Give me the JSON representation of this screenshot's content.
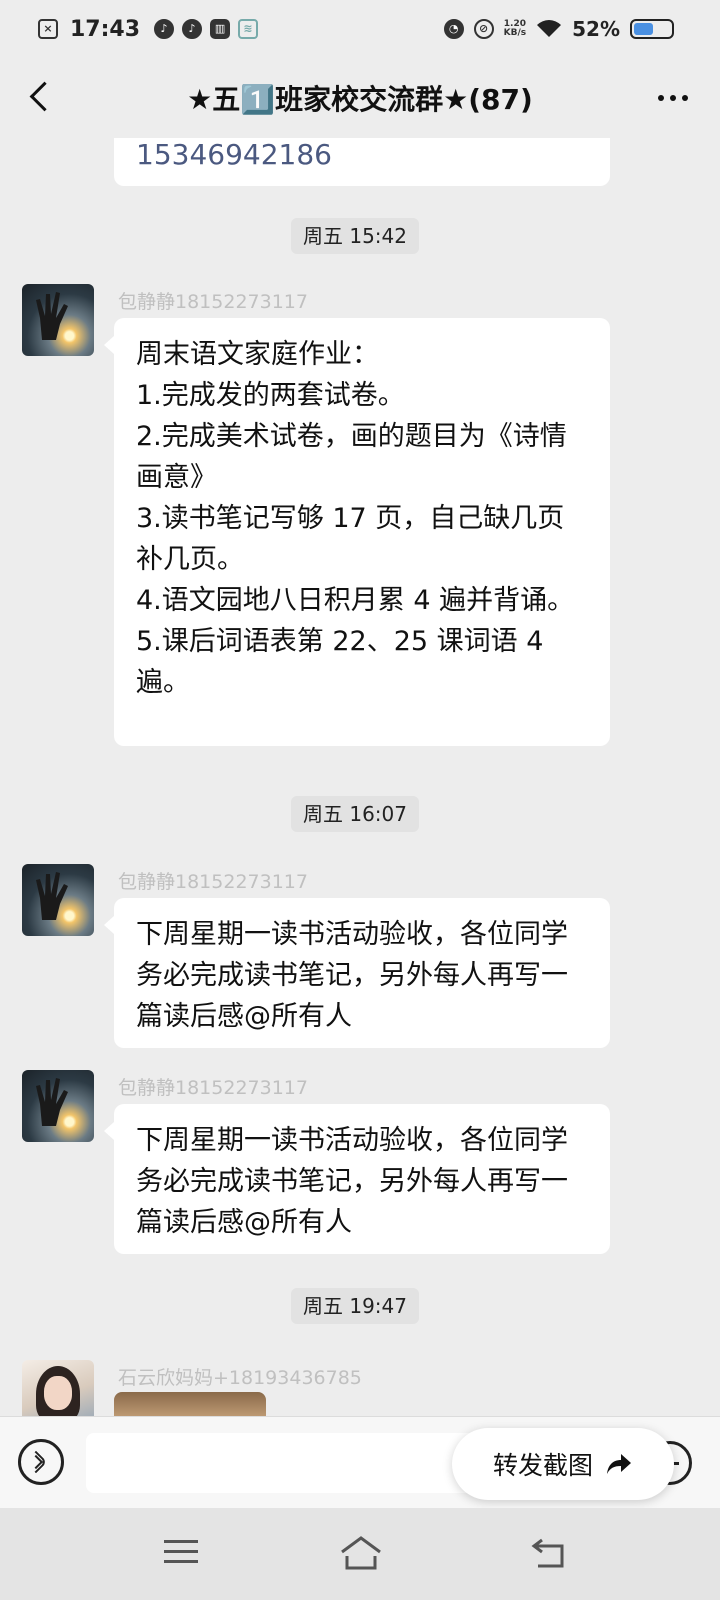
{
  "status_bar": {
    "time": "17:43",
    "net_speed_value": "1.20",
    "net_speed_unit": "KB/s",
    "battery_percent": "52%",
    "battery_level": 0.52,
    "battery_color": "#4a90e2"
  },
  "header": {
    "title": "★五1️⃣班家校交流群★(87)"
  },
  "chat": {
    "partial_message": "15346942186",
    "timestamps": [
      "周五 15:42",
      "周五 16:07",
      "周五 19:47"
    ],
    "messages": [
      {
        "sender": "包静静18152273117",
        "text": "周末语文家庭作业：\n1.完成发的两套试卷。\n2.完成美术试卷，画的题目为《诗情画意》\n3.读书笔记写够 17 页，自己缺几页补几页。\n4.语文园地八日积月累 4 遍并背诵。\n5.课后词语表第 22、25 课词语 4 遍。"
      },
      {
        "sender": "包静静18152273117",
        "text": "下周星期一读书活动验收，各位同学务必完成读书笔记，另外每人再写一篇读后感@所有人"
      },
      {
        "sender": "包静静18152273117",
        "text": "下周星期一读书活动验收，各位同学务必完成读书笔记，另外每人再写一篇读后感@所有人"
      },
      {
        "sender": "石云欣妈妈+18193436785",
        "text": ""
      }
    ]
  },
  "input_bar": {
    "forward_label": "转发截图"
  },
  "icons": {
    "back": "chevron-left-icon",
    "more": "more-dots-icon",
    "voice": "voice-icon",
    "plus": "plus-icon",
    "forward": "share-arrow-icon"
  }
}
